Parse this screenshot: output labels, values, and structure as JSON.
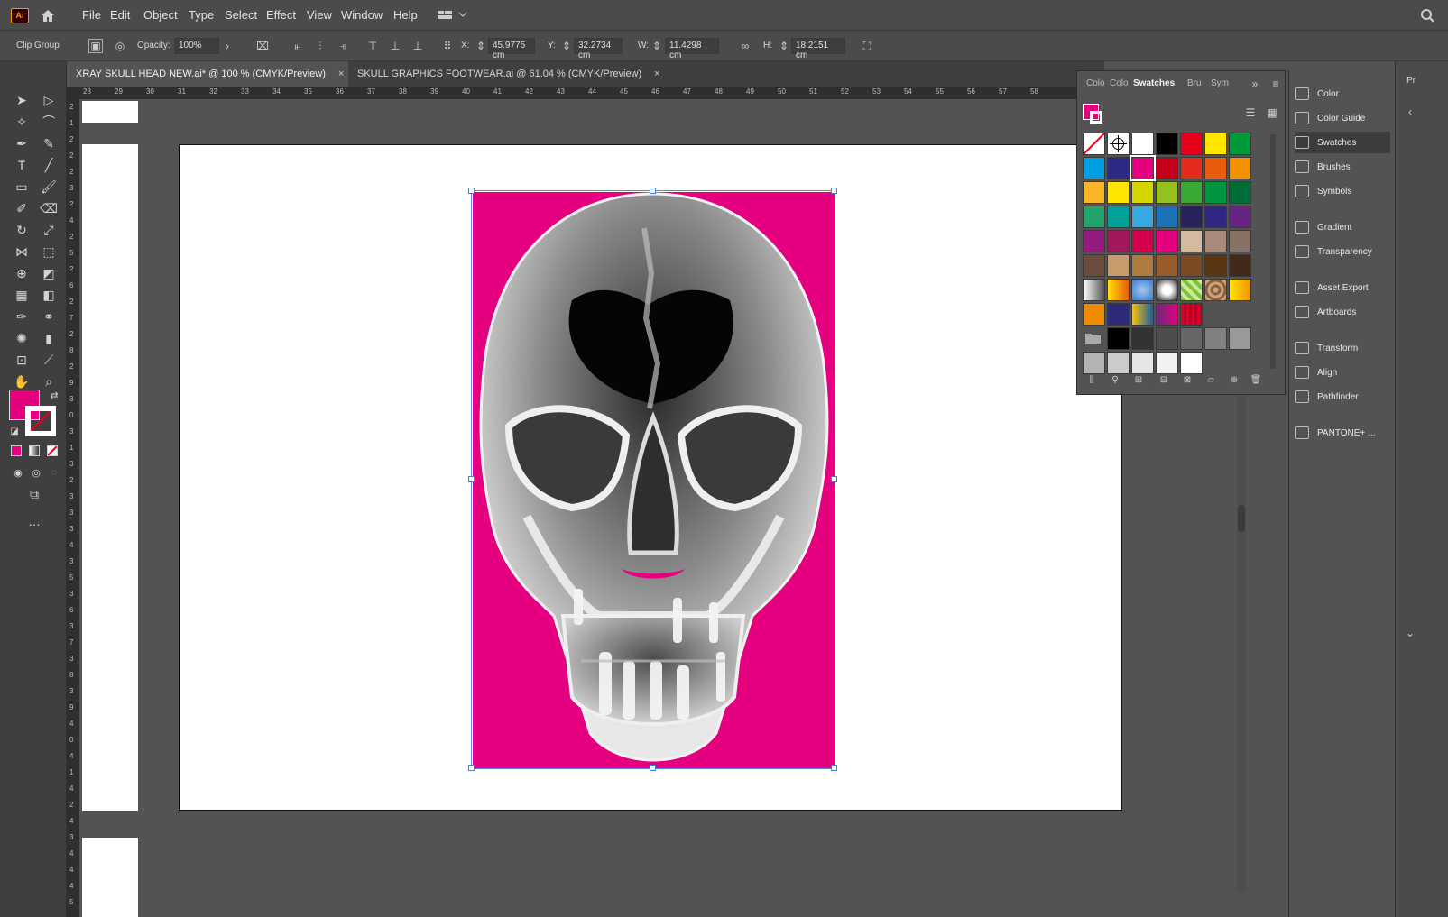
{
  "app": {
    "logo": "Ai"
  },
  "menu": [
    "File",
    "Edit",
    "Object",
    "Type",
    "Select",
    "Effect",
    "View",
    "Window",
    "Help"
  ],
  "control_bar": {
    "selection_type": "Clip Group",
    "opacity_label": "Opacity:",
    "opacity_value": "100%",
    "x_label": "X:",
    "x_value": "45.9775 cm",
    "y_label": "Y:",
    "y_value": "32.2734 cm",
    "w_label": "W:",
    "w_value": "11.4298 cm",
    "h_label": "H:",
    "h_value": "18.2151 cm"
  },
  "tabs": [
    {
      "label": "XRAY SKULL HEAD NEW.ai* @ 100 % (CMYK/Preview)",
      "close": "×"
    },
    {
      "label": "SKULL GRAPHICS FOOTWEAR.ai @ 61.04 % (CMYK/Preview)",
      "close": "×"
    }
  ],
  "ruler_top": [
    "28",
    "29",
    "30",
    "31",
    "32",
    "33",
    "34",
    "35",
    "36",
    "37",
    "38",
    "39",
    "40",
    "41",
    "42",
    "43",
    "44",
    "45",
    "46",
    "47",
    "48",
    "49",
    "50",
    "51",
    "52",
    "53",
    "54",
    "55",
    "56",
    "57",
    "58"
  ],
  "ruler_left": [
    "2",
    "1",
    "2",
    "2",
    "2",
    "3",
    "2",
    "4",
    "2",
    "5",
    "2",
    "6",
    "2",
    "7",
    "2",
    "8",
    "2",
    "9",
    "3",
    "0",
    "3",
    "1",
    "3",
    "2",
    "3",
    "3",
    "3",
    "4",
    "3",
    "5",
    "3",
    "6",
    "3",
    "7",
    "3",
    "8",
    "3",
    "9",
    "4",
    "0",
    "4",
    "1",
    "4",
    "2",
    "4",
    "3",
    "4",
    "4",
    "4",
    "5"
  ],
  "swatches_panel": {
    "tabs": [
      "Colo",
      "Colo",
      "Swatches",
      "Bru",
      "Sym"
    ],
    "rows": [
      [
        "none",
        "reg",
        "#ffffff",
        "#000000",
        "#e5001b",
        "#ffe500",
        "#009a3a"
      ],
      [
        "#009fe3",
        "#2d2a83",
        "#e4007f",
        "#c4001a",
        "#e42c1c",
        "#e95c0d",
        "#f39200"
      ],
      [
        "#fbb627",
        "#ffe500",
        "#d4d600",
        "#95c11f",
        "#3aaa35",
        "#009640",
        "#006c38"
      ],
      [
        "#23a46d",
        "#00a19a",
        "#36a9e1",
        "#1d71b8",
        "#29235c",
        "#312783",
        "#662483"
      ],
      [
        "#951b81",
        "#a2195b",
        "#d5004c",
        "#e4007f",
        "#d3bba0",
        "#a8897b",
        "#877265"
      ],
      [
        "#6b4c3d",
        "#c69c6d",
        "#b07a3f",
        "#9a5b2a",
        "#7b4a22",
        "#5b3615",
        "#42291a"
      ],
      [
        "grad1",
        "grad2",
        "grad3",
        "grad4",
        "grad5",
        "grad6",
        "grad7"
      ],
      [
        "#f08a00",
        "#2b2a7b",
        "grad8",
        "grad9",
        "grad10"
      ],
      [
        "folder",
        "#000000",
        "#333333",
        "#4d4d4d",
        "#666666",
        "#808080",
        "#999999"
      ],
      [
        "#b3b3b3",
        "#cccccc",
        "#e6e6e6",
        "#f2f2f2",
        "#ffffff"
      ]
    ]
  },
  "right_panel": [
    {
      "label": "Color",
      "icon": "color-icon"
    },
    {
      "label": "Color Guide",
      "icon": "color-guide-icon"
    },
    {
      "label": "Swatches",
      "icon": "swatches-icon",
      "active": true
    },
    {
      "label": "Brushes",
      "icon": "brushes-icon"
    },
    {
      "label": "Symbols",
      "icon": "symbols-icon"
    },
    {
      "label": "Gradient",
      "icon": "gradient-icon"
    },
    {
      "label": "Transparency",
      "icon": "transparency-icon"
    },
    {
      "label": "Asset Export",
      "icon": "asset-export-icon"
    },
    {
      "label": "Artboards",
      "icon": "artboards-icon"
    },
    {
      "label": "Transform",
      "icon": "transform-icon"
    },
    {
      "label": "Align",
      "icon": "align-icon"
    },
    {
      "label": "Pathfinder",
      "icon": "pathfinder-icon"
    },
    {
      "label": "PANTONE+ ...",
      "icon": "pantone-icon"
    }
  ],
  "fill_color": "#e4007f",
  "edge_label": "Pr"
}
